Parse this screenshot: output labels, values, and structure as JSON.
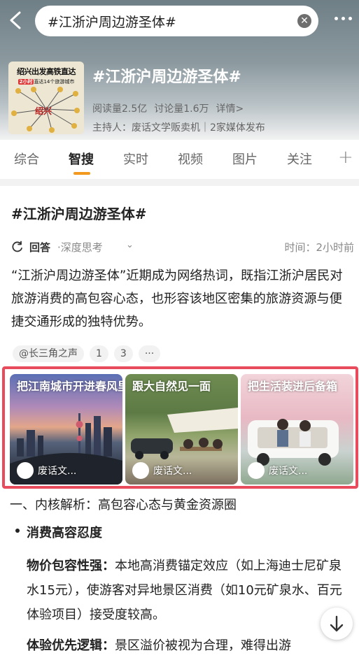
{
  "search": {
    "query": "#江浙沪周边游圣体#"
  },
  "topic": {
    "title": "#江浙沪周边游圣体#",
    "reads": "阅读量2.5亿",
    "discussions": "讨论量1.6万",
    "details": "详情>",
    "host": "主持人：废话文学贩卖机｜2家媒体发布",
    "cover_title": "绍兴出发高铁直达",
    "cover_sub_tag": "2小时",
    "cover_sub": "直达14个旅游城市",
    "cover_center": "绍兴"
  },
  "tabs": [
    "综合",
    "智搜",
    "实时",
    "视频",
    "图片",
    "关注"
  ],
  "tab_add": "+",
  "content": {
    "title": "#江浙沪周边游圣体#",
    "answer_label": "回答",
    "answer_mode": "·深度思考",
    "answer_time": "时间：2小时前",
    "paragraph": "“江浙沪周边游圣体”近期成为网络热词，既指江浙沪居民对旅游消费的高包容心态，也形容该地区密集的旅游资源与便捷交通形成的独特优势。",
    "chips": [
      "@长三角之声",
      "1",
      "3",
      "···"
    ]
  },
  "gallery": [
    {
      "caption": "把江南城市开进春风里",
      "author": "废话文..."
    },
    {
      "caption": "跟大自然见一面",
      "author": "废话文..."
    },
    {
      "caption": "把生活装进后备箱",
      "author": "废话文..."
    }
  ],
  "section": {
    "heading": "一、内核解析：高包容心态与黄金资源圈",
    "subheading": "消费高容忍度",
    "point1_label": "物价包容性强：",
    "point1_text": "本地高消费锚定效应（如上海迪士尼矿泉水15元），使游客对异地景区消费（如10元矿泉水、百元体验项目）接受度较高。",
    "point2_label": "体验优先逻辑：",
    "point2_text": "景区溢价被视为合理，难得出游"
  },
  "colors": {
    "accent": "#f39a1e",
    "highlight_frame": "#e84b5b"
  }
}
